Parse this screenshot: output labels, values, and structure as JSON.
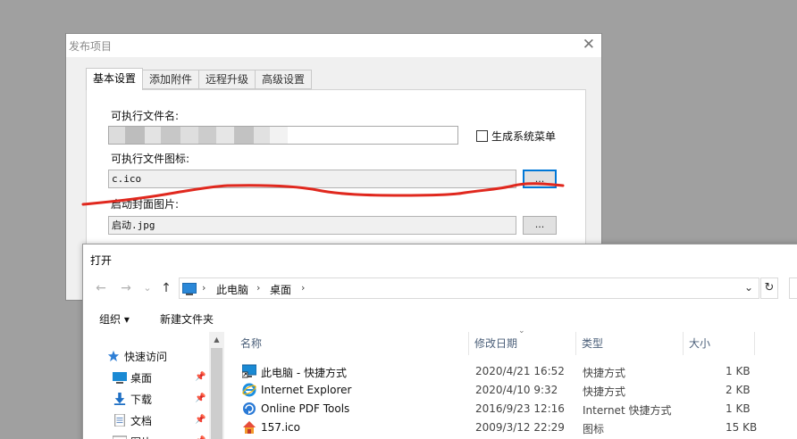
{
  "publish_dialog": {
    "title": "发布项目",
    "close_glyph": "✕",
    "tabs": [
      {
        "label": "基本设置"
      },
      {
        "label": "添加附件"
      },
      {
        "label": "远程升级"
      },
      {
        "label": "高级设置"
      }
    ],
    "exe_name_label": "可执行文件名:",
    "exe_name_value": "",
    "gen_menu_label": "生成系统菜单",
    "exe_icon_label": "可执行文件图标:",
    "exe_icon_value": "c.ico",
    "browse_label": "...",
    "splash_label": "启动封面图片:",
    "splash_value": "启动.jpg",
    "annotation_color": "#e0281e"
  },
  "open_dialog": {
    "title": "打开",
    "nav": {
      "back": "←",
      "forward": "→",
      "recent": "⌄",
      "up": "↑"
    },
    "address": {
      "crumbs": [
        "此电脑",
        "桌面"
      ],
      "sep": "›",
      "dropdown": "⌄",
      "refresh": "↻"
    },
    "toolbar": {
      "organize": "组织 ▾",
      "new_folder": "新建文件夹"
    },
    "nav_pane": [
      {
        "label": "快速访问",
        "icon": "star-icon",
        "pinned": false
      },
      {
        "label": "桌面",
        "icon": "desktop-icon",
        "pinned": true
      },
      {
        "label": "下载",
        "icon": "download-icon",
        "pinned": true
      },
      {
        "label": "文档",
        "icon": "document-icon",
        "pinned": true
      },
      {
        "label": "图片",
        "icon": "picture-icon",
        "pinned": true
      }
    ],
    "pin_glyph": "📌",
    "columns": [
      "名称",
      "修改日期",
      "类型",
      "大小"
    ],
    "files": [
      {
        "name": "此电脑 - 快捷方式",
        "date": "2020/4/21 16:52",
        "type": "快捷方式",
        "size": "1 KB",
        "icon": "computer-shortcut-icon"
      },
      {
        "name": "Internet  Explorer",
        "date": "2020/4/10 9:32",
        "type": "快捷方式",
        "size": "2 KB",
        "icon": "internet-explorer-icon"
      },
      {
        "name": "Online PDF Tools",
        "date": "2016/9/23 12:16",
        "type": "Internet 快捷方式",
        "size": "1 KB",
        "icon": "web-shortcut-icon"
      },
      {
        "name": "157.ico",
        "date": "2009/3/12 22:29",
        "type": "图标",
        "size": "15 KB",
        "icon": "house-icon"
      }
    ]
  }
}
